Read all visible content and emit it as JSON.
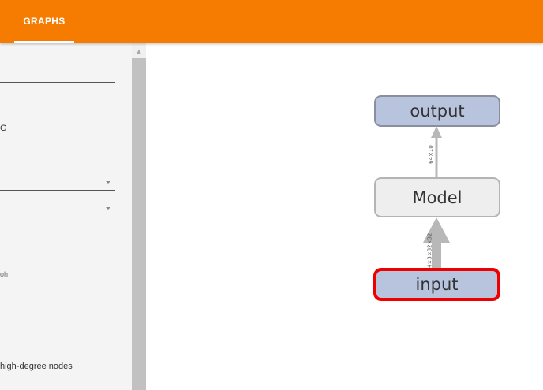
{
  "header": {
    "tabs": [
      {
        "label": "GRAPHS",
        "active": true
      }
    ],
    "background_color": "#f57c00"
  },
  "sidebar": {
    "fragments": [
      {
        "text": "G"
      },
      {
        "text": "oh"
      },
      {
        "text": "high-degree nodes"
      }
    ]
  },
  "graph": {
    "nodes": [
      {
        "id": "output",
        "label": "output",
        "kind": "io",
        "fill": "#b8c4de"
      },
      {
        "id": "model",
        "label": "Model",
        "kind": "module",
        "fill": "#eeeeee"
      },
      {
        "id": "input",
        "label": "input",
        "kind": "io",
        "fill": "#b8c4de",
        "selected": true,
        "highlight_color": "#ee0000"
      }
    ],
    "edges": [
      {
        "from": "model",
        "to": "output",
        "label": "64×10"
      },
      {
        "from": "input",
        "to": "model",
        "label": "64×3×32×32"
      }
    ]
  }
}
